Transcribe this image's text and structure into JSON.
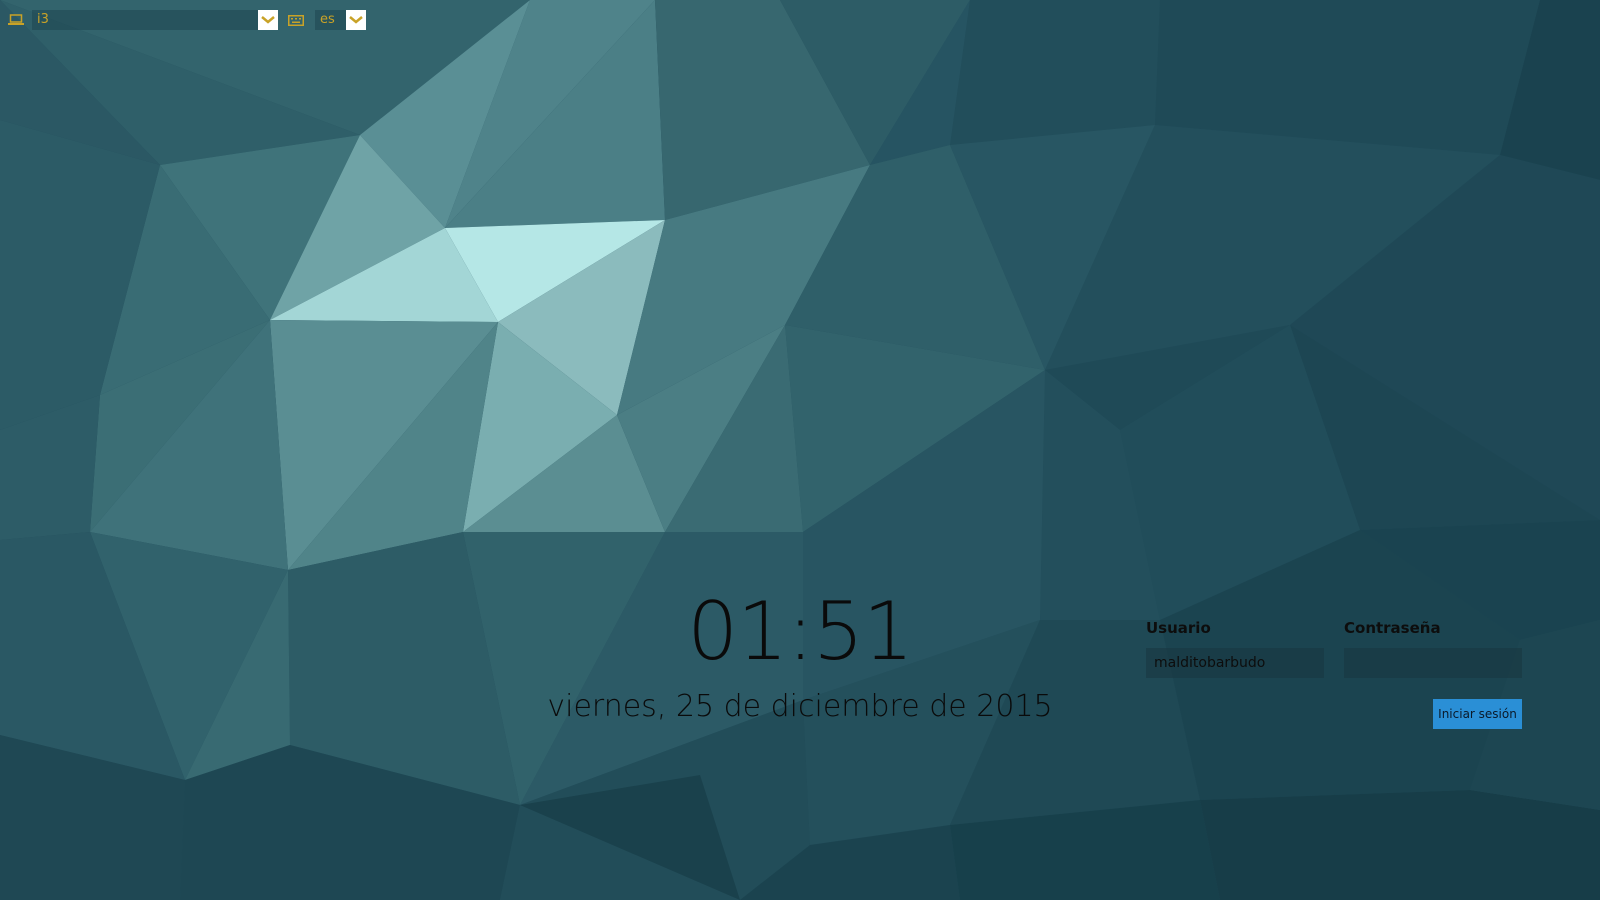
{
  "session_selector": {
    "icon": "laptop-icon",
    "value": "i3"
  },
  "layout_selector": {
    "icon": "keyboard-icon",
    "value": "es"
  },
  "clock": {
    "time": "01:51",
    "date": "viernes, 25 de diciembre de 2015"
  },
  "login": {
    "username_label": "Usuario",
    "username_value": "malditobarbudo",
    "password_label": "Contraseña",
    "password_value": "",
    "submit_label": "Iniciar sesión"
  },
  "colors": {
    "accent": "#c9a227",
    "button": "#2a8fd6",
    "background": "#244e5c"
  }
}
